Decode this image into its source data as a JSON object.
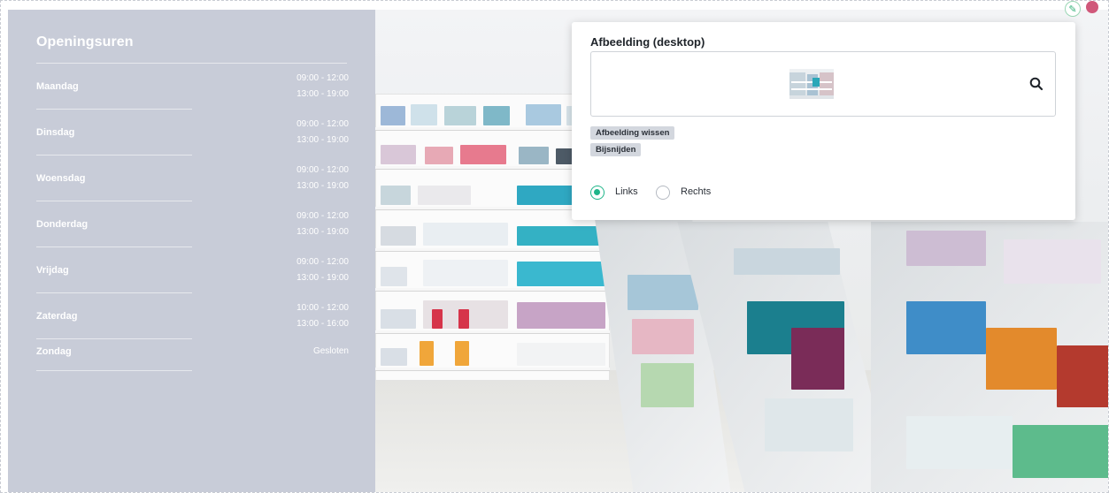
{
  "opening_hours": {
    "title": "Openingsuren",
    "days": [
      {
        "day": "Maandag",
        "slots": [
          "09:00 - 12:00",
          "13:00 - 19:00"
        ]
      },
      {
        "day": "Dinsdag",
        "slots": [
          "09:00 - 12:00",
          "13:00 - 19:00"
        ]
      },
      {
        "day": "Woensdag",
        "slots": [
          "09:00 - 12:00",
          "13:00 - 19:00"
        ]
      },
      {
        "day": "Donderdag",
        "slots": [
          "09:00 - 12:00",
          "13:00 - 19:00"
        ]
      },
      {
        "day": "Vrijdag",
        "slots": [
          "09:00 - 12:00",
          "13:00 - 19:00"
        ]
      },
      {
        "day": "Zaterdag",
        "slots": [
          "10:00 - 12:00",
          "13:00 - 16:00"
        ]
      },
      {
        "day": "Zondag",
        "slots": [
          "Gesloten"
        ]
      }
    ]
  },
  "image_popup": {
    "title": "Afbeelding (desktop)",
    "clear_label": "Afbeelding wissen",
    "crop_label": "Bijsnijden",
    "alignment_options": [
      {
        "label": "Links",
        "checked": true
      },
      {
        "label": "Rechts",
        "checked": false
      }
    ]
  },
  "icons": {
    "edit": "pencil-icon",
    "search": "magnifier-icon"
  },
  "colors": {
    "panel_bg": "#c8ccd8",
    "accent": "#1fb589",
    "chip_bg": "#d3d7de",
    "status_dot": "#d0587a"
  }
}
